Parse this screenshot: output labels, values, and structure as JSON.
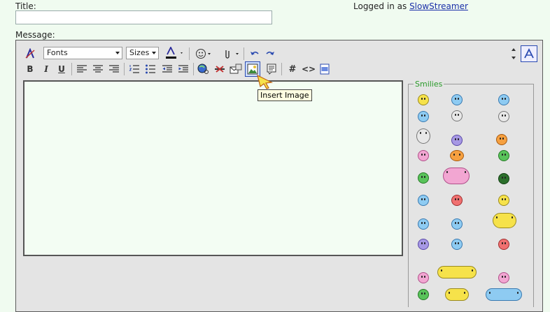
{
  "form": {
    "title_label": "Title:",
    "message_label": "Message:",
    "logged_in_prefix": "Logged in as",
    "username": "SlowStreamer"
  },
  "toolbar": {
    "fonts_select": "Fonts",
    "sizes_select": "Sizes",
    "bold": "B",
    "italic": "I",
    "underline": "U",
    "hash": "#",
    "code": "<>"
  },
  "tooltip": "Insert Image",
  "smilies": {
    "legend": "Smilies"
  },
  "icons": [
    "remove-format-icon",
    "font-color-icon",
    "smiley-icon",
    "attachment-icon",
    "undo-icon",
    "redo-icon",
    "resize-icon",
    "toggle-mode-icon",
    "align-left-icon",
    "align-center-icon",
    "align-right-icon",
    "ordered-list-icon",
    "unordered-list-icon",
    "outdent-icon",
    "indent-icon",
    "insert-link-icon",
    "remove-link-icon",
    "insert-email-icon",
    "insert-image-icon",
    "quote-icon",
    "insert-code-icon",
    "insert-youtube-icon"
  ],
  "colors": {
    "page_bg": "#f0fbf0",
    "editor_bg": "#e4e4e4",
    "textarea_bg": "#f3fdf3",
    "link": "#1a2fa8",
    "tooltip_bg": "#ffffe1",
    "legend": "#2a9a2a"
  }
}
